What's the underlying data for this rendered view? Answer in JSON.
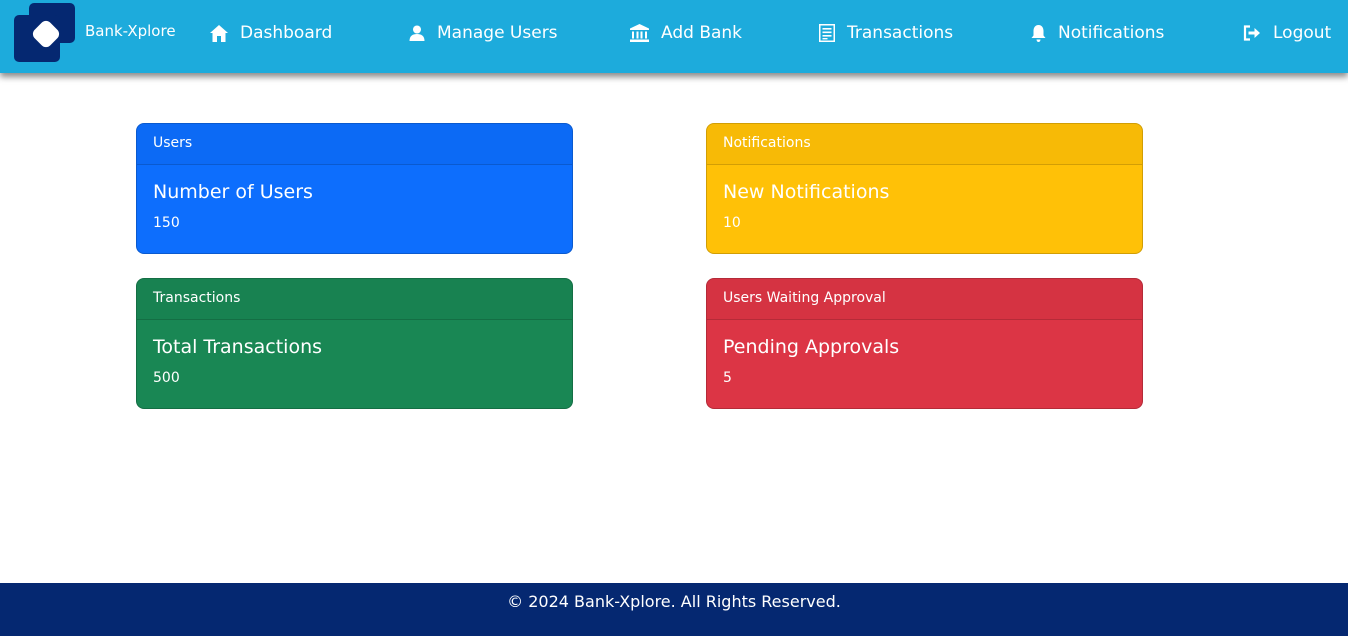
{
  "brand": {
    "name": "Bank-Xplore"
  },
  "nav": {
    "items": [
      {
        "label": "Dashboard",
        "icon": "home-icon"
      },
      {
        "label": "Manage Users",
        "icon": "user-icon"
      },
      {
        "label": "Add Bank",
        "icon": "bank-icon"
      },
      {
        "label": "Transactions",
        "icon": "receipt-icon"
      },
      {
        "label": "Notifications",
        "icon": "bell-icon"
      },
      {
        "label": "Logout",
        "icon": "logout-icon"
      }
    ]
  },
  "cards": [
    {
      "header": "Users",
      "title": "Number of Users",
      "value": "150",
      "color": "#0d6efd"
    },
    {
      "header": "Notifications",
      "title": "New Notifications",
      "value": "10",
      "color": "#ffc107"
    },
    {
      "header": "Transactions",
      "title": "Total Transactions",
      "value": "500",
      "color": "#198754"
    },
    {
      "header": "Users Waiting Approval",
      "title": "Pending Approvals",
      "value": "5",
      "color": "#dc3545"
    }
  ],
  "footer": {
    "text": "© 2024 Bank-Xplore. All Rights Reserved."
  },
  "colors": {
    "navbar": "#1dabdc",
    "footer": "#052871",
    "logo": "#052871"
  }
}
